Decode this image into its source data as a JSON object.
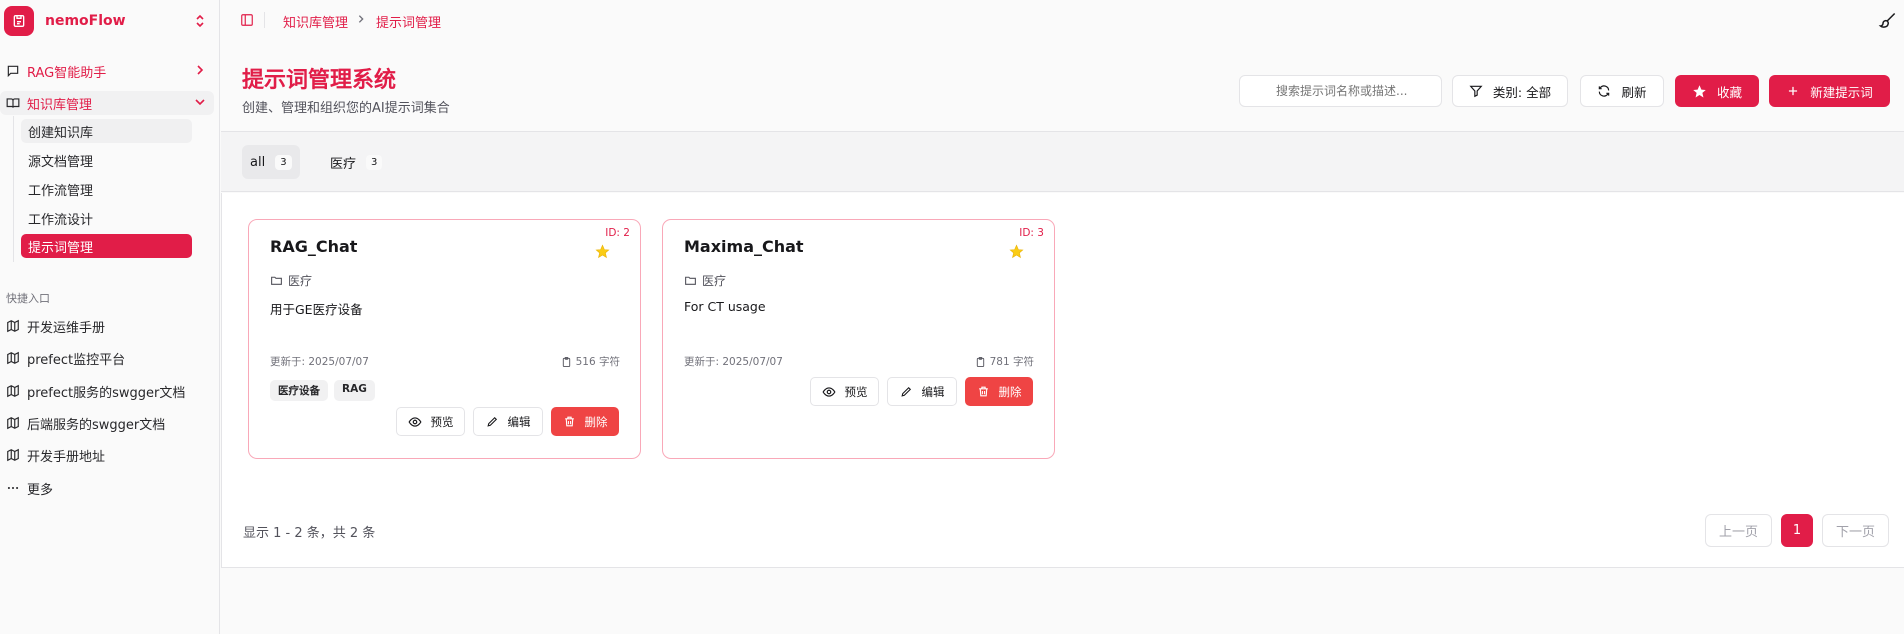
{
  "brand": {
    "name": "nemoFlow"
  },
  "sidebar": {
    "groups": [
      {
        "label": "RAG智能助手",
        "icon": "chat-icon",
        "expanded": false
      },
      {
        "label": "知识库管理",
        "icon": "book-icon",
        "expanded": true
      }
    ],
    "sub_items": [
      "创建知识库",
      "源文档管理",
      "工作流管理",
      "工作流设计",
      "提示词管理"
    ],
    "quick_label": "快捷入口",
    "quick_items": [
      "开发运维手册",
      "prefect监控平台",
      "prefect服务的swgger文档",
      "后端服务的swgger文档",
      "开发手册地址"
    ],
    "more_label": "更多"
  },
  "breadcrumb": [
    "知识库管理",
    "提示词管理"
  ],
  "header": {
    "title": "提示词管理系统",
    "subtitle": "创建、管理和组织您的AI提示词集合",
    "search_placeholder": "搜索提示词名称或描述...",
    "category_filter": "类别: 全部",
    "refresh": "刷新",
    "favorite": "收藏",
    "new_prompt": "新建提示词"
  },
  "tabs": [
    {
      "label": "all",
      "count": "3"
    },
    {
      "label": "医疗",
      "count": "3"
    }
  ],
  "cards": [
    {
      "id": "ID: 2",
      "name": "RAG_Chat",
      "category": "医疗",
      "description": "用于GE医疗设备",
      "updated": "更新于: 2025/07/07",
      "chars": "516 字符",
      "tags": [
        "医疗设备",
        "RAG"
      ],
      "starred": true
    },
    {
      "id": "ID: 3",
      "name": "Maxima_Chat",
      "category": "医疗",
      "description": "For CT usage",
      "updated": "更新于: 2025/07/07",
      "chars": "781 字符",
      "tags": [],
      "starred": true
    }
  ],
  "card_actions": {
    "preview": "预览",
    "edit": "编辑",
    "delete": "删除"
  },
  "pagination": {
    "summary": "显示 1 - 2 条，共 2 条",
    "prev": "上一页",
    "page": "1",
    "next": "下一页"
  },
  "colors": {
    "accent": "#e11d48",
    "danger": "#ef4444",
    "star": "#facc15"
  }
}
